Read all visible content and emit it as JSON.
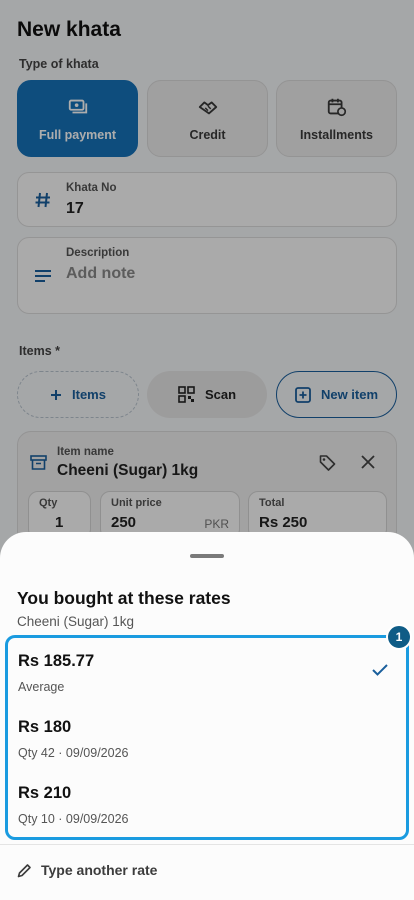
{
  "page": {
    "title": "New khata",
    "type_label": "Type of khata",
    "types": [
      {
        "label": "Full payment",
        "icon": "cash-icon",
        "active": true
      },
      {
        "label": "Credit",
        "icon": "handshake-icon",
        "active": false
      },
      {
        "label": "Installments",
        "icon": "calendar-refresh-icon",
        "active": false
      }
    ],
    "khata_no": {
      "label": "Khata No",
      "value": "17"
    },
    "description": {
      "label": "Description",
      "placeholder": "Add note"
    },
    "items_label": "Items *",
    "buttons": {
      "items": "Items",
      "scan": "Scan",
      "new_item": "New item"
    },
    "item": {
      "name_label": "Item name",
      "name": "Cheeni (Sugar) 1kg",
      "qty_label": "Qty",
      "qty": "1",
      "unit_price_label": "Unit price",
      "unit_price": "250",
      "currency": "PKR",
      "total_label": "Total",
      "total": "Rs 250"
    }
  },
  "sheet": {
    "title": "You bought at these rates",
    "subtitle": "Cheeni (Sugar) 1kg",
    "badge": "1",
    "rates": [
      {
        "value": "Rs 185.77",
        "meta": "Average",
        "selected": true
      },
      {
        "value": "Rs 180",
        "meta": "Qty 42 · 09/09/2026",
        "selected": false
      },
      {
        "value": "Rs 210",
        "meta": "Qty 10 · 09/09/2026",
        "selected": false
      }
    ],
    "another_rate": "Type another rate"
  },
  "colors": {
    "accent": "#1672b8",
    "highlight": "#1a9be0",
    "badge": "#0f5c86"
  }
}
